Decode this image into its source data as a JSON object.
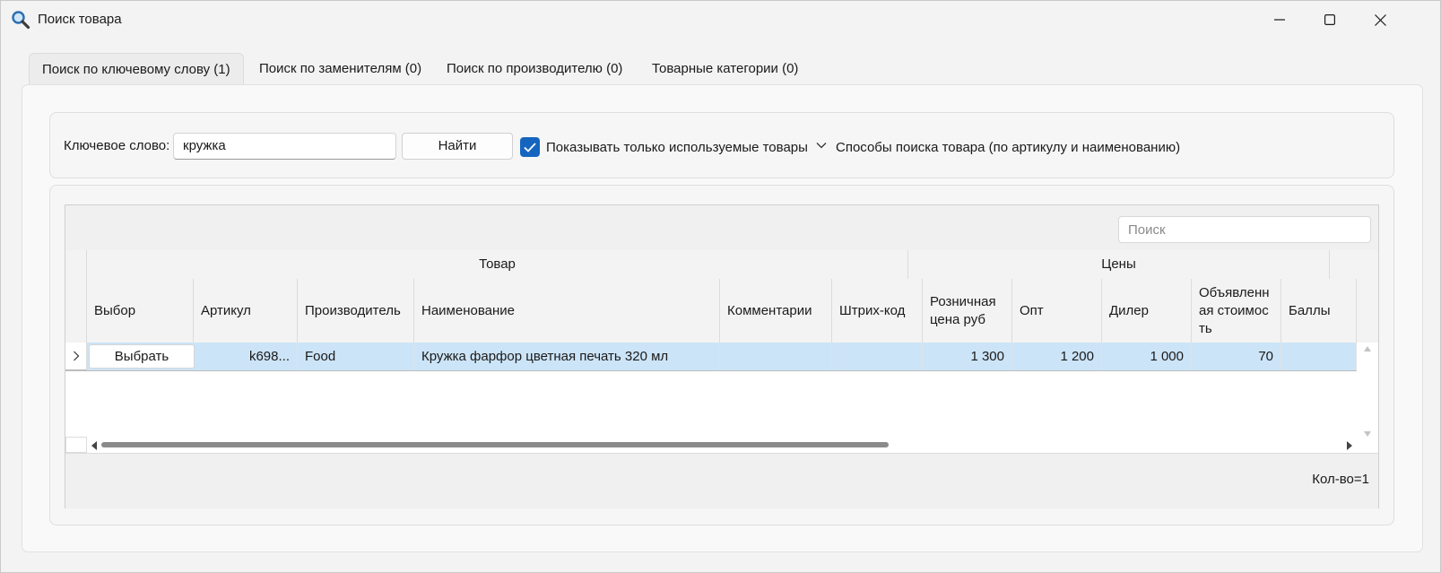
{
  "window": {
    "title": "Поиск товара"
  },
  "tabs": [
    {
      "label": "Поиск по ключевому слову (1)",
      "active": true
    },
    {
      "label": "Поиск по заменителям (0)",
      "active": false
    },
    {
      "label": "Поиск по производителю (0)",
      "active": false
    },
    {
      "label": "Товарные категории (0)",
      "active": false
    }
  ],
  "search": {
    "keyword_label": "Ключевое слово:",
    "keyword_value": "кружка",
    "find_label": "Найти",
    "only_used_label": "Показывать только используемые товары",
    "only_used_checked": true,
    "methods_label": "Способы поиска товара (по артикулу и наименованию)"
  },
  "grid": {
    "search_placeholder": "Поиск",
    "bands": {
      "product": "Товар",
      "prices": "Цены"
    },
    "columns": {
      "select": "Выбор",
      "sku": "Артикул",
      "maker": "Производитель",
      "name": "Наименование",
      "comments": "Комментарии",
      "barcode": "Штрих-код",
      "retail": "Розничная цена руб",
      "wholesale": "Опт",
      "dealer": "Дилер",
      "declared": "Объявленная стоимость",
      "points": "Баллы"
    },
    "rows": [
      {
        "select_label": "Выбрать",
        "sku": "k698...",
        "maker": "Food",
        "name": "Кружка фарфор цветная печать 320 мл",
        "comments": "",
        "barcode": "",
        "retail": "1 300",
        "wholesale": "1 200",
        "dealer": "1 000",
        "declared": "70",
        "points": ""
      }
    ],
    "count_text": "Кол-во=1",
    "horizontal_scroll_fraction": 0.62
  },
  "colors": {
    "accent": "#1565c0",
    "selected_row": "#cce4f7"
  }
}
